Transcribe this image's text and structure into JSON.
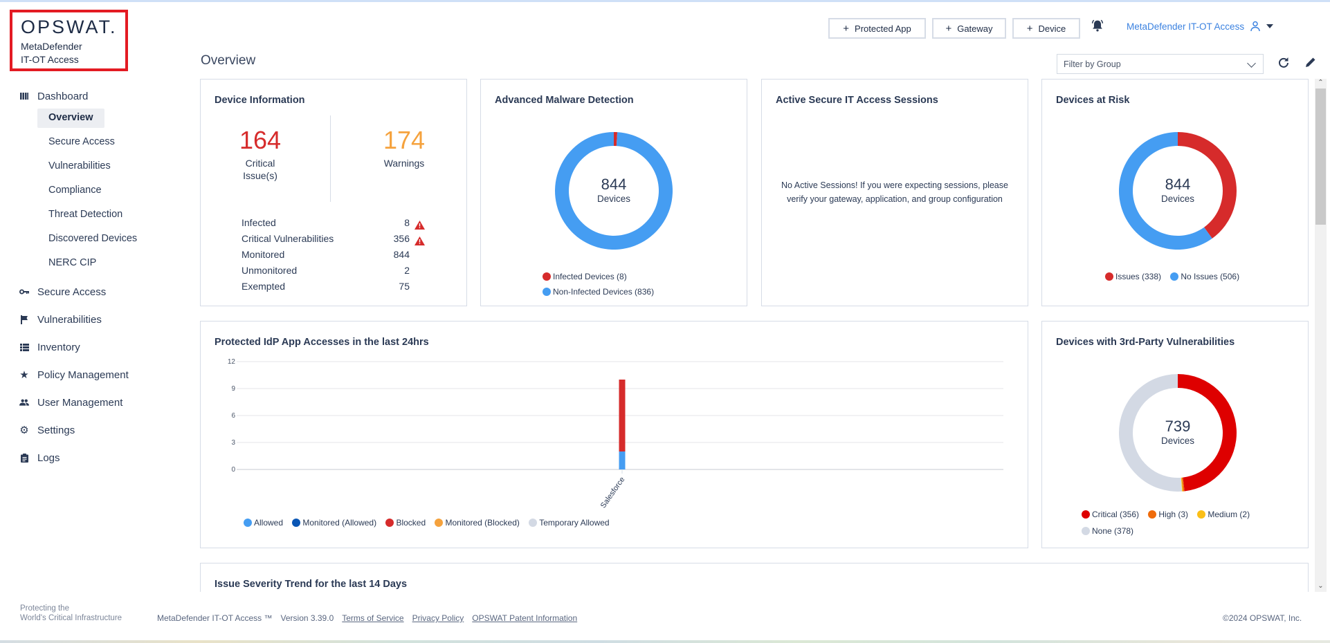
{
  "brand": {
    "name": "OPSWAT.",
    "product_line1": "MetaDefender",
    "product_line2": "IT-OT Access"
  },
  "header": {
    "buttons": [
      {
        "label": "Protected App",
        "icon": "plus-icon"
      },
      {
        "label": "Gateway",
        "icon": "plus-icon"
      },
      {
        "label": "Device",
        "icon": "plus-icon"
      }
    ],
    "notifications_icon": "bell-icon",
    "account_label": "MetaDefender IT-OT Access",
    "account_icon": "user-icon"
  },
  "sidebar": {
    "dashboard": {
      "label": "Dashboard",
      "icon": "dashboard-icon",
      "children": [
        "Overview",
        "Secure Access",
        "Vulnerabilities",
        "Compliance",
        "Threat Detection",
        "Discovered Devices",
        "NERC CIP"
      ],
      "active_child": "Overview"
    },
    "items": [
      {
        "label": "Secure Access",
        "icon": "key-icon"
      },
      {
        "label": "Vulnerabilities",
        "icon": "flag-icon"
      },
      {
        "label": "Inventory",
        "icon": "list-icon"
      },
      {
        "label": "Policy Management",
        "icon": "star-icon"
      },
      {
        "label": "User Management",
        "icon": "users-icon"
      },
      {
        "label": "Settings",
        "icon": "gear-icon"
      },
      {
        "label": "Logs",
        "icon": "clipboard-icon"
      }
    ]
  },
  "page": {
    "title": "Overview",
    "filter_placeholder": "Filter by Group"
  },
  "device_info": {
    "title": "Device Information",
    "critical": {
      "value": "164",
      "label_line1": "Critical",
      "label_line2": "Issue(s)",
      "color": "#d62b2b"
    },
    "warnings": {
      "value": "174",
      "label": "Warnings",
      "color": "#f5a23d"
    },
    "stats": [
      {
        "label": "Infected",
        "value": "8",
        "warning": true
      },
      {
        "label": "Critical Vulnerabilities",
        "value": "356",
        "warning": true
      },
      {
        "label": "Monitored",
        "value": "844",
        "warning": false
      },
      {
        "label": "Unmonitored",
        "value": "2",
        "warning": false
      },
      {
        "label": "Exempted",
        "value": "75",
        "warning": false
      }
    ]
  },
  "malware": {
    "title": "Advanced Malware Detection",
    "center_value": "844",
    "center_label": "Devices",
    "legend": [
      "Infected Devices (8)",
      "Non-Infected Devices (836)"
    ]
  },
  "sessions": {
    "title": "Active Secure IT Access Sessions",
    "empty_line1": "No Active Sessions! If you were expecting sessions, please",
    "empty_line2": "verify your gateway, application, and group configuration"
  },
  "risk": {
    "title": "Devices at Risk",
    "center_value": "844",
    "center_label": "Devices",
    "legend": [
      "Issues (338)",
      "No Issues (506)"
    ]
  },
  "idp": {
    "title": "Protected IdP App Accesses in the last 24hrs"
  },
  "vulns": {
    "title": "Devices with 3rd-Party Vulnerabilities",
    "center_value": "739",
    "center_label": "Devices",
    "legend": [
      "Critical (356)",
      "High (3)",
      "Medium (2)",
      "None (378)"
    ]
  },
  "trend": {
    "title": "Issue Severity Trend for the last 14 Days"
  },
  "footer": {
    "tagline1": "Protecting the",
    "tagline2": "World's Critical Infrastructure",
    "product": "MetaDefender IT-OT Access ™",
    "version": "Version 3.39.0",
    "links": [
      "Terms of Service",
      "Privacy Policy",
      "OPSWAT Patent Information"
    ],
    "copyright": "©2024 OPSWAT, Inc."
  },
  "chart_data": [
    {
      "type": "pie",
      "title": "Advanced Malware Detection",
      "donut": true,
      "slices": [
        {
          "label": "Infected Devices",
          "value": 8,
          "color": "#d62b2b"
        },
        {
          "label": "Non-Infected Devices",
          "value": 836,
          "color": "#459df2"
        }
      ],
      "center_text": "844 Devices"
    },
    {
      "type": "pie",
      "title": "Devices at Risk",
      "donut": true,
      "slices": [
        {
          "label": "Issues",
          "value": 338,
          "color": "#d62b2b"
        },
        {
          "label": "No Issues",
          "value": 506,
          "color": "#459df2"
        }
      ],
      "center_text": "844 Devices"
    },
    {
      "type": "bar",
      "stacked": true,
      "title": "Protected IdP App Accesses in the last 24hrs",
      "categories": [
        "Salesforce"
      ],
      "series": [
        {
          "name": "Allowed",
          "values": [
            2
          ],
          "color": "#459df2"
        },
        {
          "name": "Monitored (Allowed)",
          "values": [
            0
          ],
          "color": "#0a56b5"
        },
        {
          "name": "Blocked",
          "values": [
            8
          ],
          "color": "#d62b2b"
        },
        {
          "name": "Monitored (Blocked)",
          "values": [
            0
          ],
          "color": "#f5a23d"
        },
        {
          "name": "Temporary Allowed",
          "values": [
            0
          ],
          "color": "#d3d9e4"
        }
      ],
      "yticks": [
        0,
        3,
        6,
        9,
        12
      ],
      "ylim": [
        0,
        12
      ],
      "grid": true,
      "legend_position": "bottom",
      "xlabel": "",
      "ylabel": ""
    },
    {
      "type": "pie",
      "title": "Devices with 3rd-Party Vulnerabilities",
      "donut": true,
      "slices": [
        {
          "label": "Critical",
          "value": 356,
          "color": "#de0000"
        },
        {
          "label": "High",
          "value": 3,
          "color": "#ef6b0b"
        },
        {
          "label": "Medium",
          "value": 2,
          "color": "#fbbf17"
        },
        {
          "label": "None",
          "value": 378,
          "color": "#d3d9e4"
        }
      ],
      "center_text": "739 Devices"
    }
  ]
}
